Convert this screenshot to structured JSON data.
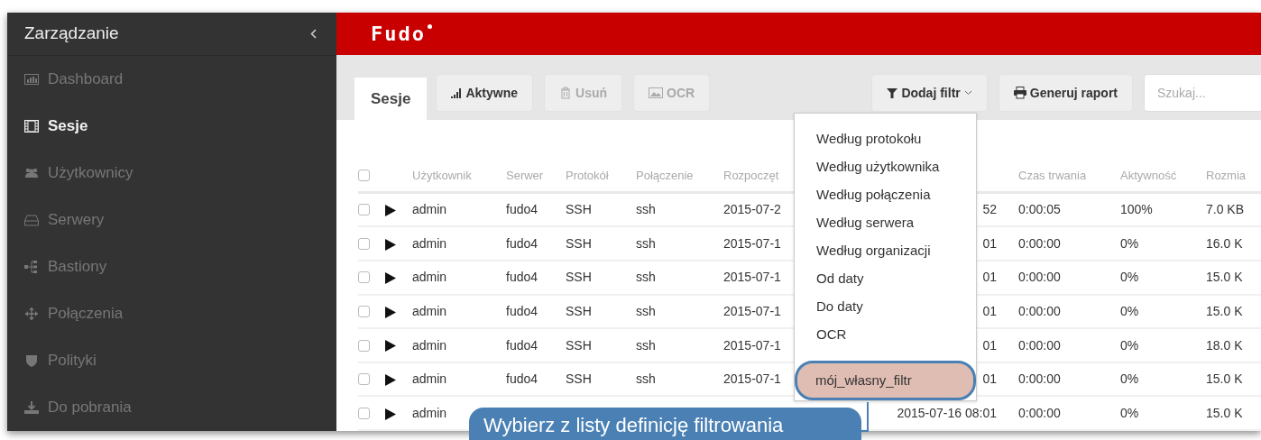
{
  "sidebar": {
    "title": "Zarządzanie",
    "items": [
      {
        "label": "Dashboard",
        "selected": false
      },
      {
        "label": "Sesje",
        "selected": true
      },
      {
        "label": "Użytkownicy",
        "selected": false
      },
      {
        "label": "Serwery",
        "selected": false
      },
      {
        "label": "Bastiony",
        "selected": false
      },
      {
        "label": "Połączenia",
        "selected": false
      },
      {
        "label": "Polityki",
        "selected": false
      },
      {
        "label": "Do pobrania",
        "selected": false
      }
    ]
  },
  "header": {
    "logo": "Fudo"
  },
  "tabs": [
    {
      "label": "Sesje",
      "selected": true
    }
  ],
  "toolbar": [
    {
      "label": "Aktywne",
      "disabled": false
    },
    {
      "label": "Usuń",
      "disabled": true
    },
    {
      "label": "OCR",
      "disabled": true
    }
  ],
  "filter_button": {
    "label": "Dodaj filtr",
    "expanded": true
  },
  "report_button": {
    "label": "Generuj raport"
  },
  "search": {
    "placeholder": "Szukaj..."
  },
  "table": {
    "all_checked": false,
    "columns": {
      "user": "Użytkownik",
      "server": "Serwer",
      "protocol": "Protokół",
      "connection": "Połączenie",
      "started": "Rozpoczęt",
      "duration": "Czas trwania",
      "activity": "Aktywność",
      "size": "Rozmia"
    },
    "rows": [
      {
        "checked": false,
        "user": "admin",
        "server": "fudo4",
        "protocol": "SSH",
        "connection": "ssh",
        "started": "2015-07-2",
        "ended": "52",
        "duration": "0:00:05",
        "activity": "100%",
        "size": "7.0 KB"
      },
      {
        "checked": false,
        "user": "admin",
        "server": "fudo4",
        "protocol": "SSH",
        "connection": "ssh",
        "started": "2015-07-1",
        "ended": "01",
        "duration": "0:00:00",
        "activity": "0%",
        "size": "16.0 K"
      },
      {
        "checked": false,
        "user": "admin",
        "server": "fudo4",
        "protocol": "SSH",
        "connection": "ssh",
        "started": "2015-07-1",
        "ended": "01",
        "duration": "0:00:00",
        "activity": "0%",
        "size": "15.0 K"
      },
      {
        "checked": false,
        "user": "admin",
        "server": "fudo4",
        "protocol": "SSH",
        "connection": "ssh",
        "started": "2015-07-1",
        "ended": "01",
        "duration": "0:00:00",
        "activity": "0%",
        "size": "15.0 K"
      },
      {
        "checked": false,
        "user": "admin",
        "server": "fudo4",
        "protocol": "SSH",
        "connection": "ssh",
        "started": "2015-07-1",
        "ended": "01",
        "duration": "0:00:00",
        "activity": "0%",
        "size": "18.0 K"
      },
      {
        "checked": false,
        "user": "admin",
        "server": "fudo4",
        "protocol": "SSH",
        "connection": "ssh",
        "started": "2015-07-1",
        "ended": "01",
        "duration": "0:00:00",
        "activity": "0%",
        "size": "15.0 K"
      },
      {
        "checked": false,
        "user": "admin",
        "ended": "2015-07-16 08:01",
        "duration": "0:00:00",
        "activity": "0%",
        "size": "15.0 K"
      }
    ]
  },
  "filter_menu": [
    {
      "label": "Według protokołu",
      "highlighted": false
    },
    {
      "label": "Według użytkownika",
      "highlighted": false
    },
    {
      "label": "Według połączenia",
      "highlighted": false
    },
    {
      "label": "Według serwera",
      "highlighted": false
    },
    {
      "label": "Według organizacji",
      "highlighted": false
    },
    {
      "label": "Od daty",
      "highlighted": false
    },
    {
      "label": "Do daty",
      "highlighted": false
    },
    {
      "label": "OCR",
      "highlighted": false
    },
    {
      "label": "mój_własny_filtr",
      "highlighted": true
    }
  ],
  "callout": {
    "text": "Wybierz z listy definicję filtrowania"
  }
}
